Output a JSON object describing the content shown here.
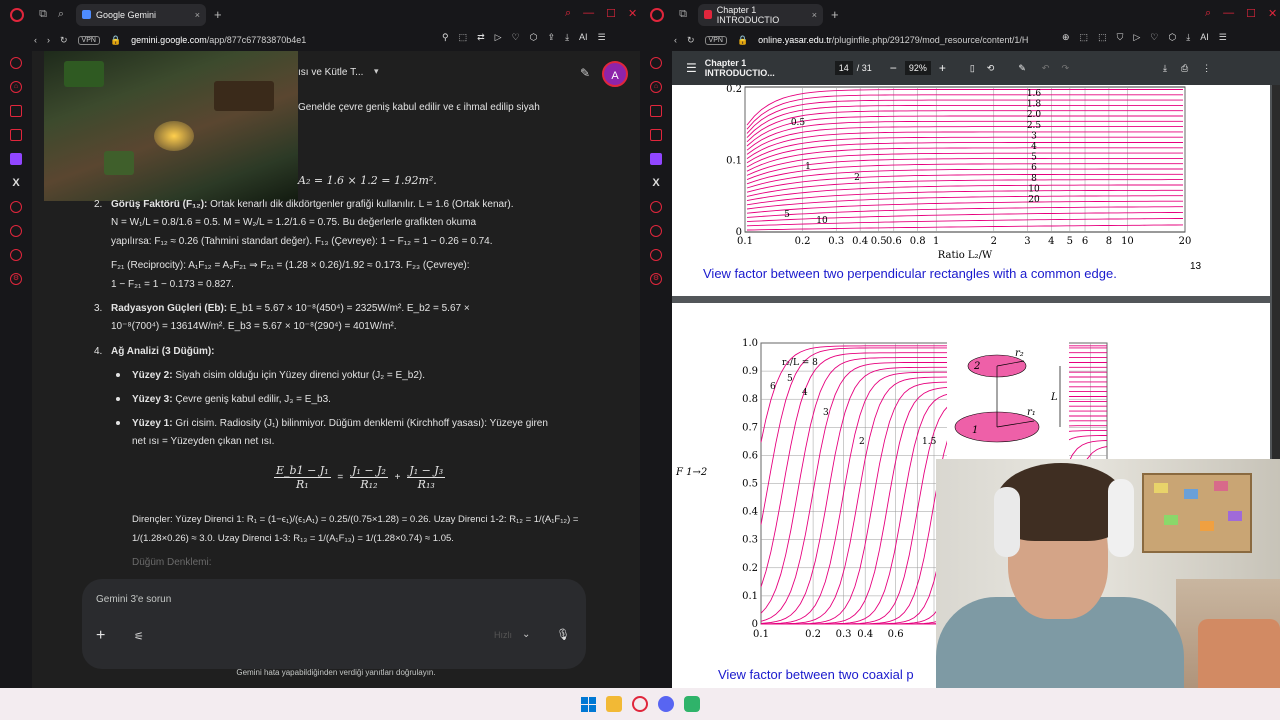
{
  "left_window": {
    "tab_title": "Google Gemini",
    "url_host": "gemini.google.com",
    "url_path": "/app/877c67783870b4e1",
    "vpn_label": "VPN",
    "ai_label": "AI"
  },
  "gemini": {
    "chat_title": "ısı ve Kütle T...",
    "avatar_letter": "A",
    "intro_text": "Genelde çevre geniş kabul edilir ve ϵ ihmal edilip siyah",
    "area_eq": "A₂ = 1.6 × 1.2 = 1.92m².",
    "s2_num": "2.",
    "s2_title": "Görüş Faktörü (F₁₂):",
    "s2_l1": "Ortak kenarlı dik dikdörtgenler grafiği kullanılır. L = 1.6 (Ortak kenar).",
    "s2_l2": "N = W₁/L = 0.8/1.6 = 0.5. M = W₂/L = 1.2/1.6 = 0.75. Bu değerlerle grafikten okuma",
    "s2_l3": "yapılırsa: F₁₂ ≈ 0.26 (Tahmini standart değer). F₁₃ (Çevreye): 1 − F₁₂ = 1 − 0.26 = 0.74.",
    "s2_l4": "F₂₁ (Reciprocity): A₁F₁₂ = A₂F₂₁ ⇒ F₂₁ = (1.28 × 0.26)/1.92 ≈ 0.173. F₂₃ (Çevreye):",
    "s2_l5": "1 − F₂₁ = 1 − 0.173 = 0.827.",
    "s3_num": "3.",
    "s3_title": "Radyasyon Güçleri (Eb):",
    "s3_l1": "E_b1 = 5.67 × 10⁻⁸(450⁴) = 2325W/m². E_b2 = 5.67 ×",
    "s3_l2": "10⁻⁸(700⁴) = 13614W/m². E_b3 = 5.67 × 10⁻⁸(290⁴) = 401W/m².",
    "s4_num": "4.",
    "s4_title": "Ağ Analizi (3 Düğüm):",
    "b1_title": "Yüzey 2:",
    "b1_text": "Siyah cisim olduğu için Yüzey direnci yoktur (J₂ = E_b2).",
    "b2_title": "Yüzey 3:",
    "b2_text": "Çevre geniş kabul edilir, J₃ = E_b3.",
    "b3_title": "Yüzey 1:",
    "b3_text": "Gri cisim. Radiosity (J₁) bilinmiyor. Düğüm denklemi (Kirchhoff yasası): Yüzeye giren",
    "b3_text2": "net ısı = Yüzeyden çıkan net ısı.",
    "eq_lhs_num": "E_b1 − J₁",
    "eq_lhs_den": "R₁",
    "eq_eq": "=",
    "eq_m_num": "J₁ − J₂",
    "eq_m_den": "R₁₂",
    "eq_plus": "+",
    "eq_r_num": "J₁ − J₃",
    "eq_r_den": "R₁₃",
    "res_l1": "Dirençler: Yüzey Direnci 1: R₁ = (1−ϵ₁)/(ϵ₁A₁) = 0.25/(0.75×1.28) = 0.26. Uzay Direnci 1-2: R₁₂ = 1/(A₁F₁₂) =",
    "res_l2": "1/(1.28×0.26) ≈ 3.0. Uzay Direnci 1-3: R₁₃ = 1/(A₁F₁₃) = 1/(1.28×0.74) ≈ 1.05.",
    "faded": "Düğüm Denklemi:",
    "prompt_placeholder": "Gemini 3'e sorun",
    "model_label": "Hızlı",
    "disclaimer": "Gemini hata yapabildiğinden verdiği yanıtları doğrulayın."
  },
  "right_window": {
    "tab_title": "Chapter 1 INTRODUCTIO",
    "url_host": "online.yasar.edu.tr",
    "url_path": "/pluginfile.php/291279/mod_resource/content/1/H",
    "vpn_label": "VPN",
    "ai_label": "AI"
  },
  "pdf": {
    "title": "Chapter 1 INTRODUCTIO...",
    "page_current": "14",
    "page_total": "/ 31",
    "zoom": "92%",
    "page_number": "13",
    "caption1": "View factor between two perpendicular rectangles with a common edge.",
    "caption2": "View factor between two coaxial p"
  },
  "chart_data": [
    {
      "type": "line",
      "title": "",
      "xlabel": "Ratio L₂/W",
      "x_ticks": [
        "0.1",
        "0.2",
        "0.3",
        "0.4",
        "0.5",
        "0.6",
        "0.8",
        "1",
        "2",
        "3",
        "4",
        "5",
        "6",
        "8",
        "10",
        "20"
      ],
      "y_ticks": [
        "0",
        "0.1",
        "0.2"
      ],
      "curve_labels_left": [
        "0.5",
        "1",
        "2",
        "5",
        "10"
      ],
      "curve_labels_right": [
        "1.6",
        "1.8",
        "2.0",
        "2.5",
        "3",
        "4",
        "5",
        "6",
        "8",
        "10",
        "20"
      ],
      "color": "#e6007e"
    },
    {
      "type": "line",
      "ylabel": "F 1→2",
      "y_ticks": [
        "0",
        "0.1",
        "0.2",
        "0.3",
        "0.4",
        "0.5",
        "0.6",
        "0.7",
        "0.8",
        "0.9",
        "1.0"
      ],
      "x_ticks": [
        "0.1",
        "0.2",
        "0.3",
        "0.4",
        "0.6"
      ],
      "curve_labels": [
        "r₂/L = 8",
        "6",
        "5",
        "4",
        "3",
        "2",
        "1.5"
      ],
      "diagram_labels": [
        "2",
        "r₂",
        "L",
        "r₁",
        "1"
      ],
      "color": "#e6007e"
    }
  ]
}
